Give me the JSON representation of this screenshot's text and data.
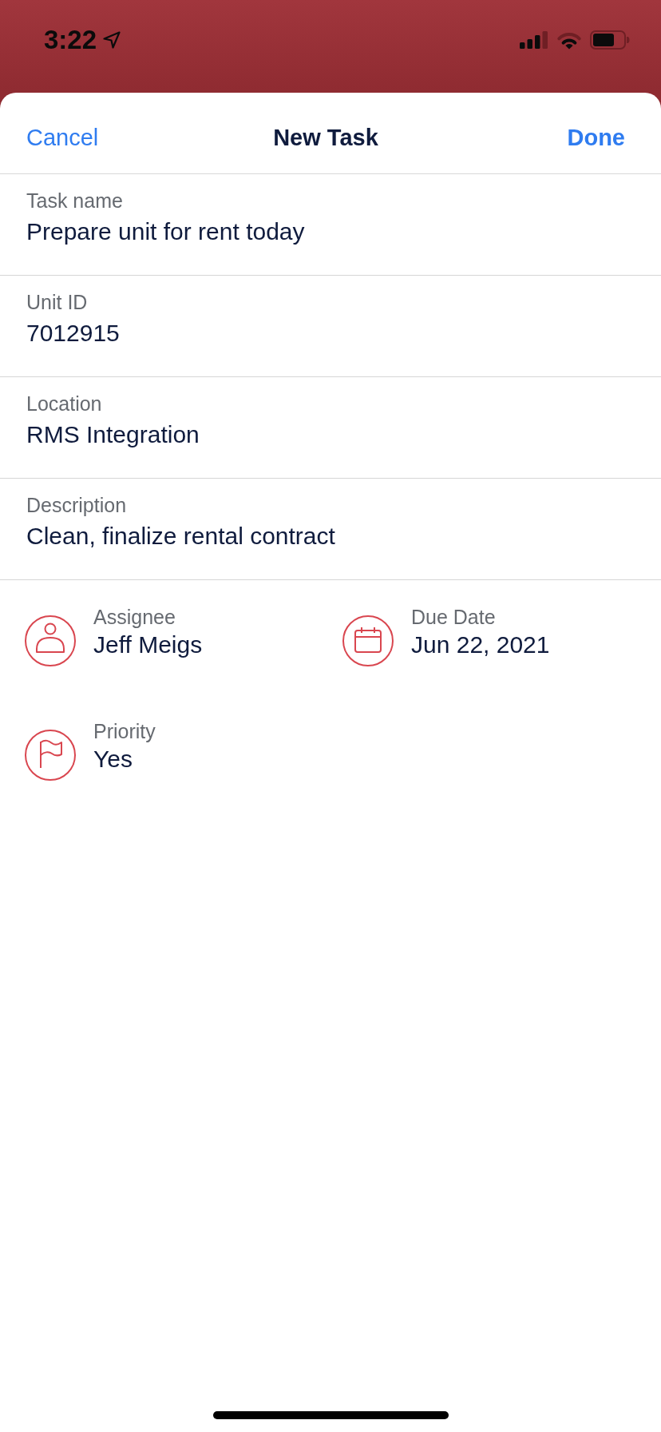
{
  "status_bar": {
    "time": "3:22"
  },
  "header": {
    "cancel": "Cancel",
    "title": "New Task",
    "done": "Done"
  },
  "fields": [
    {
      "label": "Task name",
      "value": "Prepare unit for rent today"
    },
    {
      "label": "Unit ID",
      "value": "7012915"
    },
    {
      "label": "Location",
      "value": "RMS Integration"
    },
    {
      "label": "Description",
      "value": "Clean, finalize rental contract"
    }
  ],
  "details": [
    {
      "kind": "person",
      "label": "Assignee",
      "value": "Jeff Meigs"
    },
    {
      "kind": "calendar",
      "label": "Due Date",
      "value": "Jun 22, 2021"
    },
    {
      "kind": "flag",
      "label": "Priority",
      "value": "Yes"
    }
  ]
}
